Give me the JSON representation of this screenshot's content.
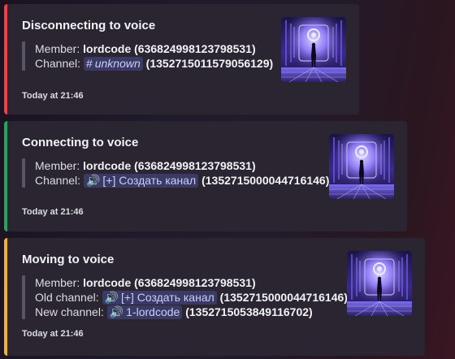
{
  "embeds": [
    {
      "title": "Disconnecting to voice",
      "accent": "#f23f43",
      "member_label": "Member:",
      "member_name": "lordcode",
      "member_id": "(636824998123798531)",
      "channel_label": "Channel:",
      "channel_icon": "hash-icon",
      "channel_glyph": "#",
      "channel_name": "unknown",
      "channel_id": "(1352715011579056129)",
      "timestamp": "Today at 21:46"
    },
    {
      "title": "Connecting to voice",
      "accent": "#23a55a",
      "member_label": "Member:",
      "member_name": "lordcode",
      "member_id": "(636824998123798531)",
      "channel_label": "Channel:",
      "channel_icon": "speaker-icon",
      "channel_glyph": "🔊",
      "channel_name": "[+] Создать канал",
      "channel_id": "(1352715000044716146)",
      "timestamp": "Today at 21:46"
    },
    {
      "title": "Moving to voice",
      "accent": "#f0b232",
      "member_label": "Member:",
      "member_name": "lordcode",
      "member_id": "(636824998123798531)",
      "old_channel_label": "Old channel:",
      "old_channel_icon": "speaker-icon",
      "old_channel_glyph": "🔊",
      "old_channel_name": "[+] Создать канал",
      "old_channel_id": "(1352715000044716146)",
      "new_channel_label": "New channel:",
      "new_channel_icon": "speaker-icon",
      "new_channel_glyph": "🔊",
      "new_channel_name": "1-lordcode",
      "new_channel_id": "(1352715053849116702)",
      "timestamp": "Today at 21:46"
    }
  ]
}
